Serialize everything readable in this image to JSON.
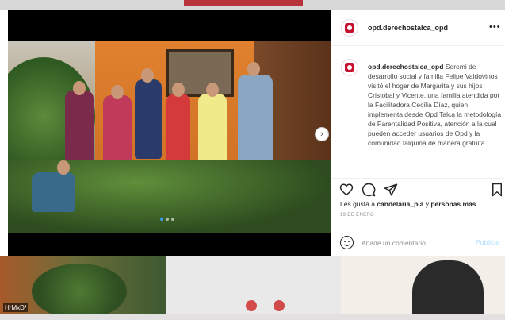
{
  "post": {
    "username": "opd.derechostalca_opd",
    "more_label": "•••",
    "caption_username": "opd.derechostalca_opd",
    "caption_text": "Seremi de desarrollo social y familia Felipe Valdovinos visitó el hogar de Margarita y sus hijos Cristobal y Vicente, una familia atendida por la Facilitadora Cecilia Díaz, quien implementa desde Opd Talca la metodología de Parentalidad Positiva, atención a la cual pueden acceder usuarios de Opd y la comunidad talquina de manera gratuita.",
    "likes_prefix": "Les gusta a ",
    "likes_user": "candelaria_pia",
    "likes_suffix": " y ",
    "likes_more": "personas más",
    "date": "19 DE ENERO",
    "carousel_next": "›"
  },
  "comment": {
    "placeholder": "Añade un comentario...",
    "publish_label": "Publicar"
  },
  "background": {
    "label": "HrMxD/"
  },
  "icons": [
    "heart-icon",
    "comment-icon",
    "share-icon",
    "bookmark-icon",
    "emoji-icon",
    "more-options-icon",
    "carousel-next-icon"
  ],
  "colors": {
    "publish_disabled": "#b2dffc",
    "carousel_dot_active": "#3b9bf0",
    "brand_red": "#c8102e"
  }
}
